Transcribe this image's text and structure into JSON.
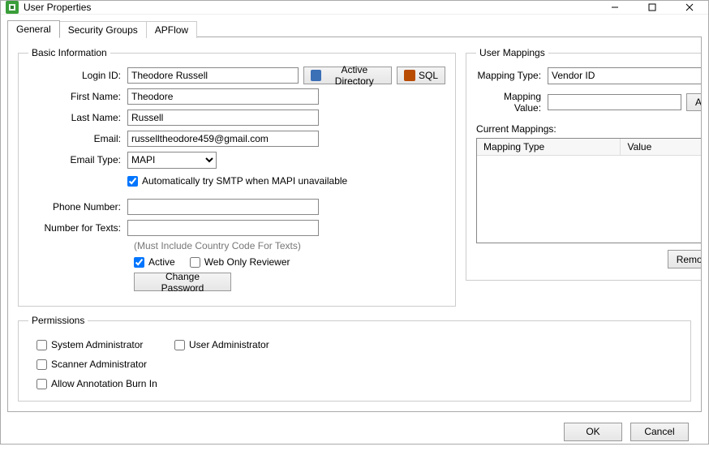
{
  "window": {
    "title": "User Properties"
  },
  "tabs": {
    "general": "General",
    "security": "Security Groups",
    "apflow": "APFlow"
  },
  "basic": {
    "legend": "Basic Information",
    "labels": {
      "login": "Login ID:",
      "first": "First Name:",
      "last": "Last Name:",
      "email": "Email:",
      "emailType": "Email Type:",
      "phone": "Phone Number:",
      "texts": "Number for Texts:"
    },
    "values": {
      "login": "Theodore Russell",
      "first": "Theodore",
      "last": "Russell",
      "email": "russelltheodore459@gmail.com",
      "emailType": "MAPI",
      "phone": "",
      "texts": ""
    },
    "ad_button": "Active Directory",
    "sql_button": "SQL",
    "auto_smtp": "Automatically try SMTP when MAPI unavailable",
    "hint_country": "(Must Include Country Code For Texts)",
    "active_label": "Active",
    "web_only_label": "Web Only Reviewer",
    "change_password": "Change Password",
    "checks": {
      "auto_smtp": true,
      "active": true,
      "web_only": false
    }
  },
  "mapping": {
    "legend": "User Mappings",
    "labels": {
      "type": "Mapping Type:",
      "value": "Mapping Value:",
      "current": "Current Mappings:"
    },
    "type_value": "Vendor ID",
    "value_value": "",
    "add": "Add",
    "remove": "Remove",
    "columns": {
      "type": "Mapping Type",
      "value": "Value"
    },
    "rows": []
  },
  "permissions": {
    "legend": "Permissions",
    "sys_admin": "System Administrator",
    "user_admin": "User Administrator",
    "scanner_admin": "Scanner Administrator",
    "annotation": "Allow Annotation Burn In",
    "checks": {
      "sys_admin": false,
      "user_admin": false,
      "scanner_admin": false,
      "annotation": false
    }
  },
  "footer": {
    "ok": "OK",
    "cancel": "Cancel"
  }
}
